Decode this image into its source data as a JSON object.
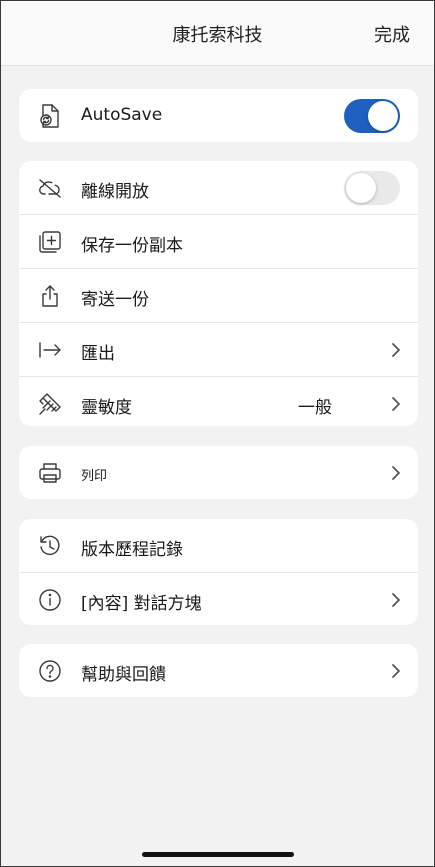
{
  "header": {
    "title": "康托索科技",
    "done_label": "完成"
  },
  "autosave": {
    "label": "AutoSave",
    "enabled": true
  },
  "file_actions": {
    "offline": {
      "label": "離線開放",
      "enabled": false
    },
    "save_copy": {
      "label": "保存一份副本"
    },
    "send_copy": {
      "label": "寄送一份"
    },
    "export": {
      "label": "匯出"
    },
    "sensitivity": {
      "label": "靈敏度",
      "value": "一般"
    }
  },
  "print": {
    "label": "列印"
  },
  "info": {
    "version_history": {
      "label": "版本歷程記錄"
    },
    "properties": {
      "label": "[內容] 對話方塊"
    }
  },
  "help": {
    "label": "幫助與回饋"
  },
  "colors": {
    "accent": "#1f5fbf",
    "background": "#f2f2f2",
    "card": "#ffffff"
  },
  "icons": [
    "autosave-file-icon",
    "cloud-off-icon",
    "save-copy-icon",
    "share-icon",
    "export-arrow-icon",
    "sensitivity-icon",
    "printer-icon",
    "history-icon",
    "info-icon",
    "help-icon",
    "chevron-right-icon"
  ]
}
